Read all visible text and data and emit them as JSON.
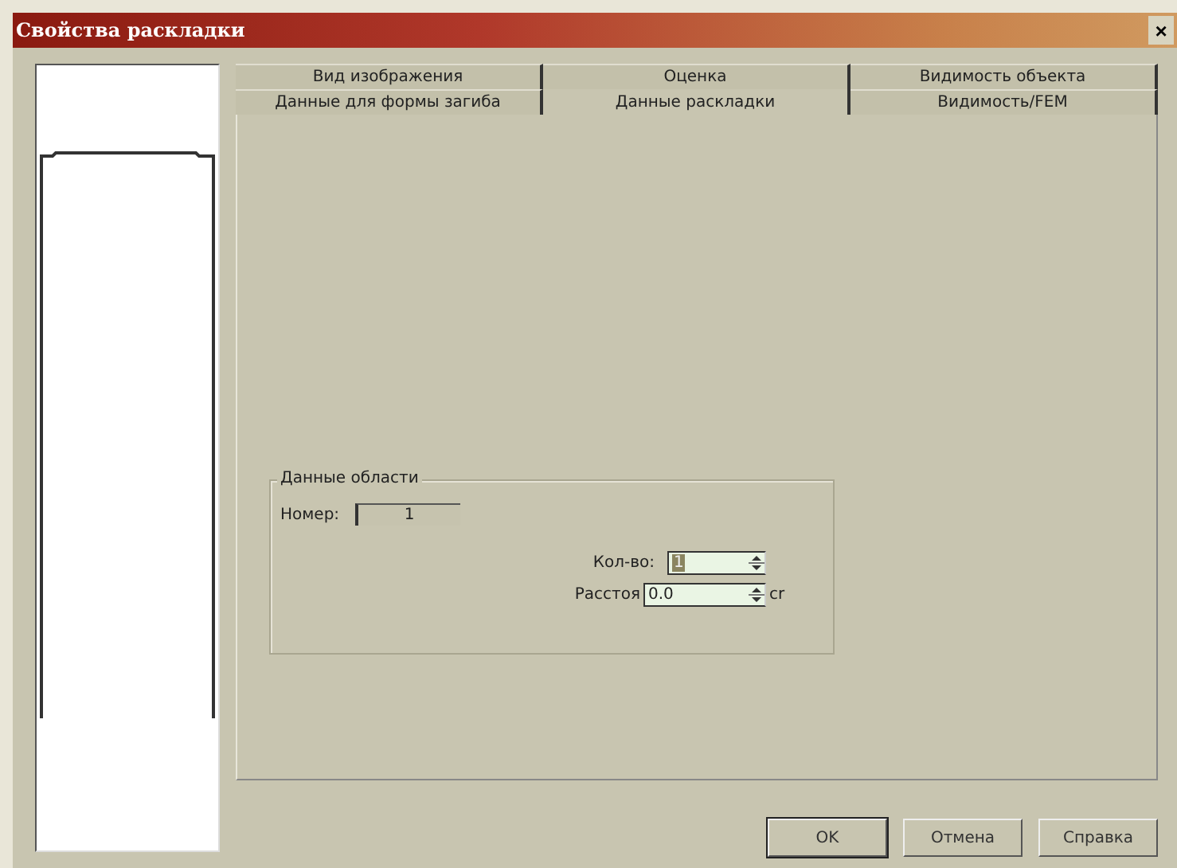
{
  "window": {
    "title": "Свойства раскладки",
    "close": "×"
  },
  "tab_rows": [
    [
      {
        "label": "Вид изображения",
        "selected": false
      },
      {
        "label": "Оценка",
        "selected": false
      },
      {
        "label": "Видимость объекта",
        "selected": false
      }
    ],
    [
      {
        "label": "Данные для формы загиба",
        "selected": false
      },
      {
        "label": "Данные раскладки",
        "selected": true
      },
      {
        "label": "Видимость/FEM",
        "selected": false
      }
    ]
  ],
  "group": {
    "title": "Данные области",
    "number": {
      "label": "Номер:",
      "value": "1"
    },
    "count": {
      "label": "Кол-во:",
      "value": "1"
    },
    "distance": {
      "label": "Расстоя",
      "value": "0.0",
      "unit": "cr"
    }
  },
  "buttons": [
    {
      "label": "OK",
      "default": true
    },
    {
      "label": "Отмена",
      "default": false
    },
    {
      "label": "Справка",
      "default": false
    }
  ]
}
